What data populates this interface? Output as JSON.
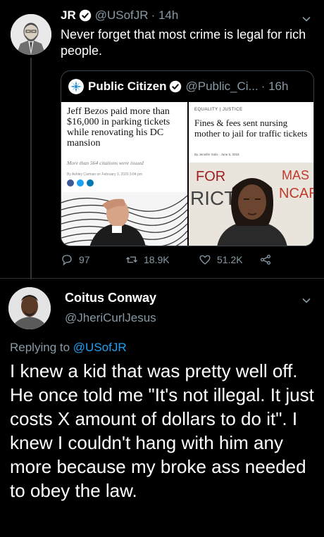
{
  "tweet": {
    "author_name": "JR",
    "author_handle": "@USofJR",
    "time": "· 14h",
    "text": "Never forget that most crime is legal for rich people.",
    "quoted": {
      "author_name": "Public Citizen",
      "author_handle": "@Public_Ci...",
      "time": "· 16h",
      "left_article": {
        "title": "Jeff Bezos paid more than $16,000 in parking tickets while renovating his DC mansion",
        "subtitle": "More than 564 citations were issued",
        "byline": "By Ashley Carman on February 3, 2020 3:04 pm"
      },
      "right_article": {
        "tag": "EQUALITY | JUSTICE",
        "title": "Fines & fees sent nursing mother to jail for traffic tickets",
        "byline": "By Jennifer Solis · June 5, 2018",
        "sign_text_1": "FOR",
        "sign_text_2": "RICT A",
        "sign_text_3": "MAS",
        "sign_text_4": "NCAR"
      }
    },
    "stats": {
      "replies": "97",
      "retweets": "18.9K",
      "likes": "51.2K"
    }
  },
  "reply": {
    "author_name": "Coitus Conway",
    "author_handle": "@JheriCurlJesus",
    "replying_prefix": "Replying to",
    "replying_to": "@USofJR",
    "text": "I knew a kid that was pretty well off. He once told me \"It's not illegal. It just costs X amount of dollars to do it\". I knew I couldn't hang with him any more because my broke ass needed to obey the law."
  },
  "colors": {
    "background": "#000000",
    "muted": "#8899a6",
    "link": "#1da1f2",
    "verified": "#1da1f2",
    "border": "#38444d"
  },
  "icons": [
    "verified-icon",
    "chevron-down-icon",
    "reply-icon",
    "retweet-icon",
    "like-icon",
    "share-icon"
  ]
}
